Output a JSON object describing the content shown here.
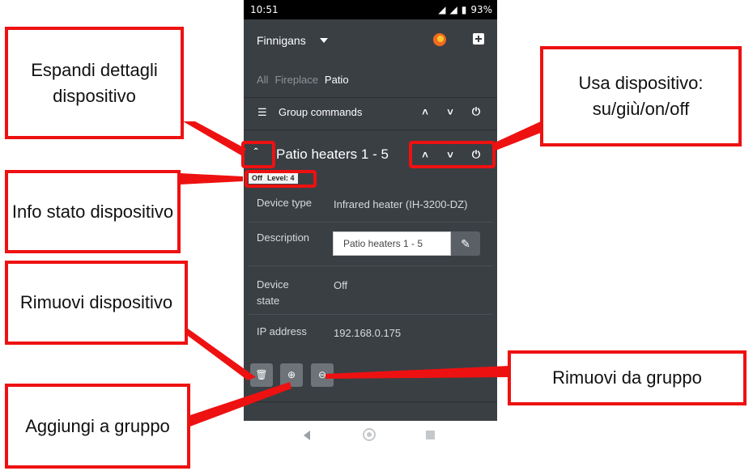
{
  "status_bar": {
    "time": "10:51",
    "battery": "93%"
  },
  "header": {
    "location": "Finnigans"
  },
  "tabs": [
    {
      "label": "All",
      "active": false
    },
    {
      "label": "Fireplace",
      "active": false
    },
    {
      "label": "Patio",
      "active": true
    }
  ],
  "group": {
    "label": "Group commands"
  },
  "device": {
    "title": "Patio heaters 1 - 5",
    "state_short": "Off",
    "level_text": "Level: 4",
    "details": {
      "type_label": "Device type",
      "type_value": "Infrared heater (IH-3200-DZ)",
      "description_label": "Description",
      "description_value": "Patio heaters 1 - 5",
      "state_label_1": "Device",
      "state_label_2": "state",
      "state_value": "Off",
      "ip_label": "IP address",
      "ip_value": "192.168.0.175"
    }
  },
  "callouts": {
    "expand": "Espandi dettagli dispositivo",
    "use": "Usa dispositivo: su/giù/on/off",
    "info": "Info stato dispositivo",
    "remove_device": "Rimuovi dispositivo",
    "remove_group": "Rimuovi da gruppo",
    "add_group": "Aggiungi a gruppo"
  },
  "colors": {
    "annotation_red": "#ee1111",
    "app_background": "#3a3f44",
    "flame_orange": "#f26b1d"
  }
}
